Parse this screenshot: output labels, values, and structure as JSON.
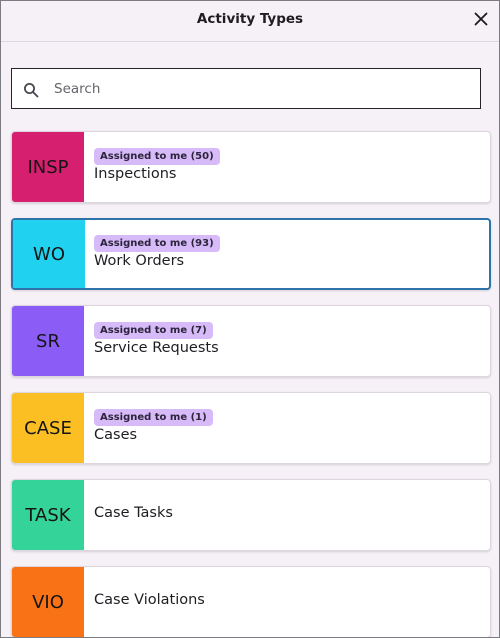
{
  "dialog": {
    "title": "Activity Types"
  },
  "search": {
    "placeholder": "Search",
    "value": ""
  },
  "activity_types": [
    {
      "code": "INSP",
      "name": "Inspections",
      "badge": "Assigned to me (50)",
      "color": "#d61f6f"
    },
    {
      "code": "WO",
      "name": "Work Orders",
      "badge": "Assigned to me (93)",
      "color": "#20d2ef",
      "selected": true
    },
    {
      "code": "SR",
      "name": "Service Requests",
      "badge": "Assigned to me (7)",
      "color": "#8b5cf6"
    },
    {
      "code": "CASE",
      "name": "Cases",
      "badge": "Assigned to me (1)",
      "color": "#fbbf24"
    },
    {
      "code": "TASK",
      "name": "Case Tasks",
      "badge": "",
      "color": "#34d399"
    },
    {
      "code": "VIO",
      "name": "Case Violations",
      "badge": "",
      "color": "#f97316"
    }
  ],
  "colors": {
    "background": "#f6f1f7",
    "badge_bg": "#d6bbf8",
    "selected_border": "#2e74a8"
  },
  "icons": {
    "close": "close-icon",
    "search": "search-icon"
  }
}
